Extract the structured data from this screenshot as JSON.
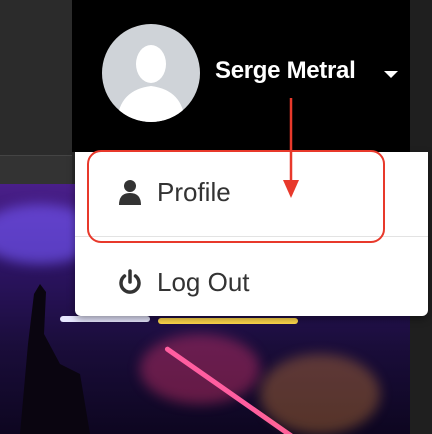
{
  "user": {
    "name": "Serge Metral"
  },
  "menu": {
    "items": [
      {
        "label": "Profile",
        "icon": "user-icon"
      },
      {
        "label": "Log Out",
        "icon": "power-icon"
      }
    ]
  },
  "colors": {
    "header_bg": "#000000",
    "annotation": "#e8392b",
    "menu_text": "#333333"
  }
}
